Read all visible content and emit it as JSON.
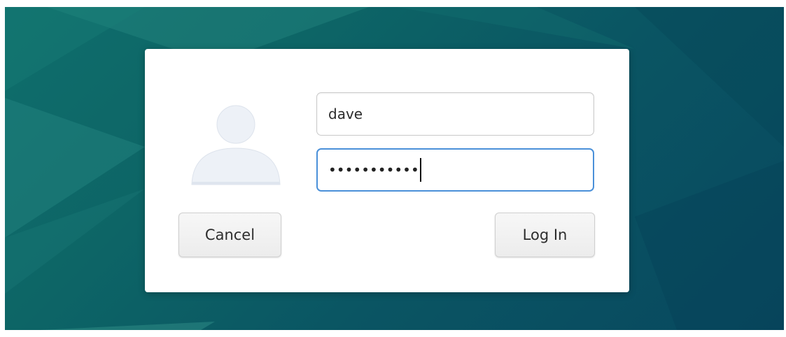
{
  "login_dialog": {
    "username_value": "dave",
    "password_mask": "•••••••••••",
    "cancel_label": "Cancel",
    "login_label": "Log In"
  },
  "icons": {
    "avatar": "user-avatar-icon"
  },
  "colors": {
    "desktop_teal": "#0d6566",
    "desktop_dark": "#08485f",
    "focus_border": "#4a90d9",
    "dialog_bg": "#ffffff"
  }
}
